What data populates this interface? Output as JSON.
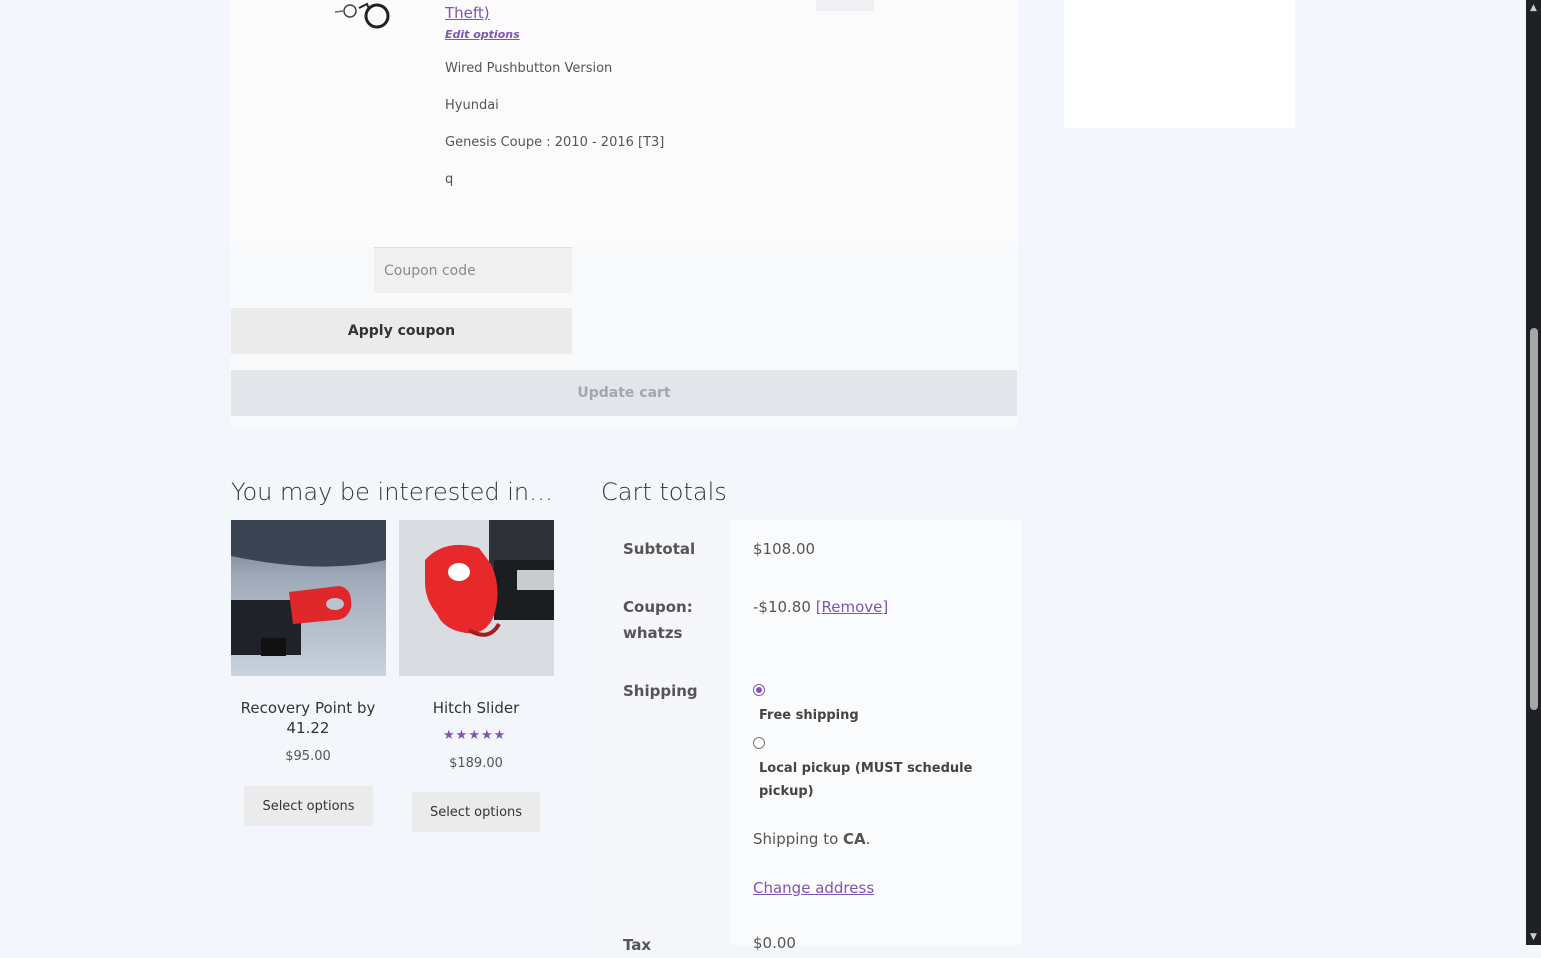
{
  "cart_item": {
    "product_link": "Theft)",
    "edit_options": "Edit options",
    "meta": [
      "Wired Pushbutton Version",
      "Hyundai",
      "Genesis Coupe : 2010 - 2016 [T3]",
      "q"
    ]
  },
  "actions": {
    "coupon_placeholder": "Coupon code",
    "apply_coupon": "Apply coupon",
    "update_cart": "Update cart"
  },
  "cross_sells": {
    "heading": "You may be interested in…",
    "products": [
      {
        "title": "Recovery Point by 41.22",
        "price": "$95.00",
        "button": "Select options"
      },
      {
        "title": "Hitch Slider",
        "price": "$189.00",
        "rating": 5,
        "button": "Select options"
      }
    ]
  },
  "cart_totals": {
    "heading": "Cart totals",
    "subtotal_label": "Subtotal",
    "subtotal_value": "$108.00",
    "coupon_label": "Coupon: whatzs",
    "coupon_value": "-$10.80",
    "coupon_remove": "[Remove]",
    "shipping_label": "Shipping",
    "shipping_options": [
      "Free shipping",
      "Local pickup (MUST schedule pickup)"
    ],
    "shipping_selected": 0,
    "shipping_to_prefix": "Shipping to ",
    "shipping_to_region": "CA",
    "shipping_to_suffix": ".",
    "change_address": "Change address",
    "tax_label": "Tax",
    "tax_value": "$0.00"
  },
  "colors": {
    "accent": "#7f54b3",
    "page_bg": "#f3f6fb",
    "button_bg": "#ebebeb"
  }
}
